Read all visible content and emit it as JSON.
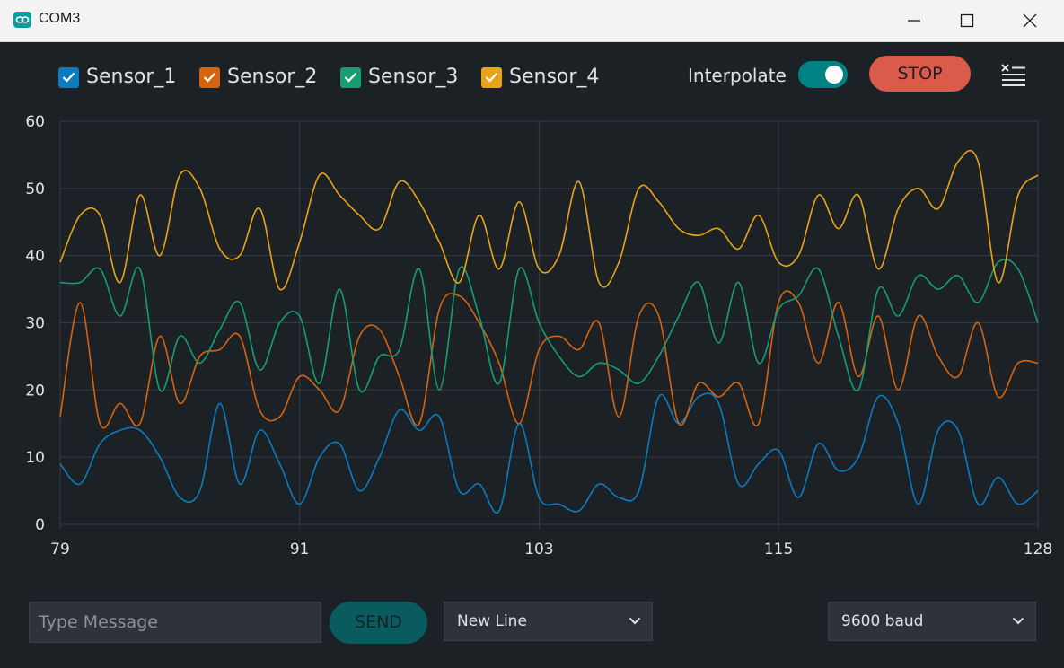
{
  "window": {
    "title": "COM3",
    "app_icon": "arduino-infinity-icon",
    "controls": [
      "minimize-icon",
      "maximize-icon",
      "close-icon"
    ]
  },
  "toolbar": {
    "legend": [
      {
        "label": "Sensor_1",
        "color": "#0a7cbf",
        "checked": true
      },
      {
        "label": "Sensor_2",
        "color": "#d6640e",
        "checked": true
      },
      {
        "label": "Sensor_3",
        "color": "#169d70",
        "checked": true
      },
      {
        "label": "Sensor_4",
        "color": "#e8a317",
        "checked": true
      }
    ],
    "interpolate_label": "Interpolate",
    "interpolate_on": true,
    "stop_label": "STOP",
    "clear_icon": "clear-output-icon",
    "accent": "#008184",
    "stop_color": "#da5b4a"
  },
  "chart_data": {
    "type": "line",
    "x": [
      79,
      80,
      81,
      82,
      83,
      84,
      85,
      86,
      87,
      88,
      89,
      90,
      91,
      92,
      93,
      94,
      95,
      96,
      97,
      98,
      99,
      100,
      101,
      102,
      103,
      104,
      105,
      106,
      107,
      108,
      109,
      110,
      111,
      112,
      113,
      114,
      115,
      116,
      117,
      118,
      119,
      120,
      121,
      122,
      123,
      124,
      125,
      126,
      127,
      128
    ],
    "x_ticks": [
      79,
      91,
      103,
      115,
      128
    ],
    "y_ticks": [
      0,
      10,
      20,
      30,
      40,
      50,
      60
    ],
    "xlim": [
      79,
      128
    ],
    "ylim": [
      0,
      60
    ],
    "grid": true,
    "series": [
      {
        "name": "Sensor_1",
        "color": "#0a7cbf",
        "values": [
          9,
          6,
          12,
          14,
          14,
          10,
          4,
          5,
          18,
          6,
          14,
          9,
          3,
          10,
          12,
          5,
          10,
          17,
          14,
          16,
          5,
          6,
          2,
          15,
          4,
          3,
          2,
          6,
          4,
          5,
          19,
          15,
          19,
          18,
          6,
          9,
          11,
          4,
          12,
          8,
          10,
          19,
          15,
          3,
          14,
          14,
          3,
          7,
          3,
          5
        ]
      },
      {
        "name": "Sensor_2",
        "color": "#d6640e",
        "values": [
          16,
          33,
          15,
          18,
          15,
          28,
          18,
          25,
          26,
          28,
          17,
          16,
          22,
          20,
          17,
          28,
          29,
          22,
          15,
          32,
          34,
          30,
          24,
          15,
          26,
          28,
          26,
          30,
          16,
          31,
          31,
          15,
          21,
          19,
          21,
          15,
          33,
          33,
          24,
          33,
          22,
          31,
          20,
          31,
          25,
          22,
          30,
          19,
          24,
          24
        ]
      },
      {
        "name": "Sensor_3",
        "color": "#169d70",
        "values": [
          36,
          36,
          38,
          31,
          38,
          20,
          28,
          24,
          29,
          33,
          23,
          30,
          31,
          21,
          35,
          20,
          25,
          26,
          38,
          20,
          38,
          31,
          21,
          38,
          30,
          25,
          22,
          24,
          23,
          21,
          25,
          31,
          36,
          27,
          36,
          24,
          32,
          34,
          38,
          28,
          20,
          35,
          31,
          37,
          35,
          37,
          33,
          39,
          38,
          30
        ]
      },
      {
        "name": "Sensor_4",
        "color": "#e8a317",
        "values": [
          39,
          46,
          46,
          36,
          49,
          40,
          52,
          50,
          41,
          40,
          47,
          35,
          42,
          52,
          49,
          46,
          44,
          51,
          48,
          42,
          36,
          46,
          38,
          48,
          38,
          40,
          51,
          36,
          39,
          50,
          48,
          44,
          43,
          44,
          41,
          46,
          39,
          40,
          49,
          44,
          49,
          38,
          47,
          50,
          47,
          54,
          54,
          36,
          49,
          52
        ]
      }
    ]
  },
  "footer": {
    "message_placeholder": "Type Message",
    "send_label": "SEND",
    "line_ending": "New Line",
    "baud_rate": "9600 baud"
  }
}
